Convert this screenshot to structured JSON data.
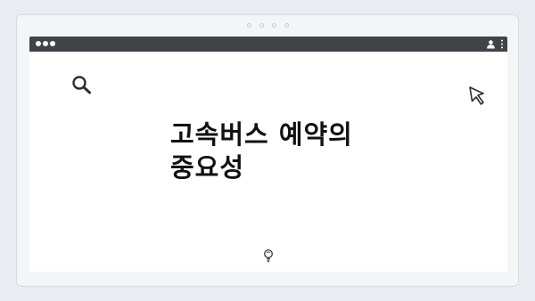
{
  "page": {
    "headline_line1": "고속버스 예약의",
    "headline_line2": "중요성"
  },
  "icons": {
    "search": "search-icon",
    "cursor": "cursor-arrow-icon",
    "user": "user-icon",
    "menu": "kebab-menu-icon",
    "bulb": "lightbulb-icon"
  },
  "colors": {
    "titlebar": "#404449",
    "background": "#e9edf1",
    "text": "#111111"
  }
}
